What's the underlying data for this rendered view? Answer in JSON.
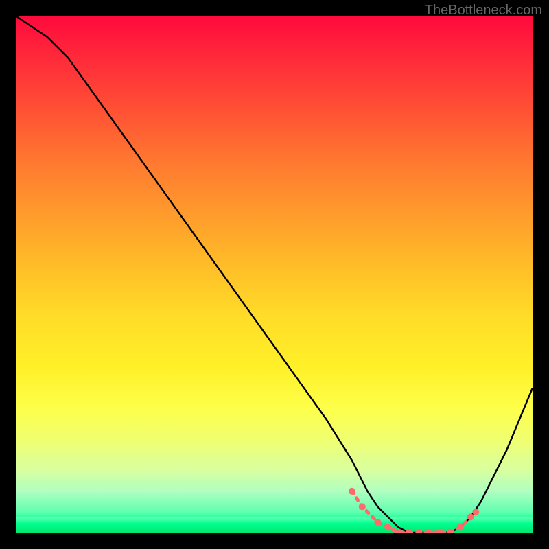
{
  "watermark": "TheBottleneck.com",
  "chart_data": {
    "type": "line",
    "title": "",
    "xlabel": "",
    "ylabel": "",
    "xlim": [
      0,
      100
    ],
    "ylim": [
      0,
      100
    ],
    "grid": false,
    "series": [
      {
        "name": "bottleneck-curve",
        "x": [
          0,
          3,
          6,
          10,
          20,
          30,
          40,
          50,
          60,
          65,
          68,
          70,
          72,
          74,
          76,
          78,
          80,
          82,
          84,
          86,
          88,
          90,
          95,
          100
        ],
        "values": [
          100,
          98,
          96,
          92,
          78,
          64,
          50,
          36,
          22,
          14,
          8,
          5,
          3,
          1,
          0,
          0,
          0,
          0,
          0,
          1,
          3,
          6,
          16,
          28
        ]
      }
    ],
    "markers": {
      "name": "bottleneck-markers",
      "x": [
        65,
        67,
        70,
        72,
        74,
        76,
        78,
        80,
        82,
        84,
        86,
        88,
        89
      ],
      "values": [
        8,
        5,
        2,
        1,
        0,
        0,
        0,
        0,
        0,
        0,
        1,
        3,
        4
      ],
      "color": "#ff6b6b"
    },
    "colors": {
      "curve": "#000000",
      "marker": "#ff6b6b",
      "gradient_top": "#ff0a3c",
      "gradient_bottom": "#00e870"
    }
  }
}
